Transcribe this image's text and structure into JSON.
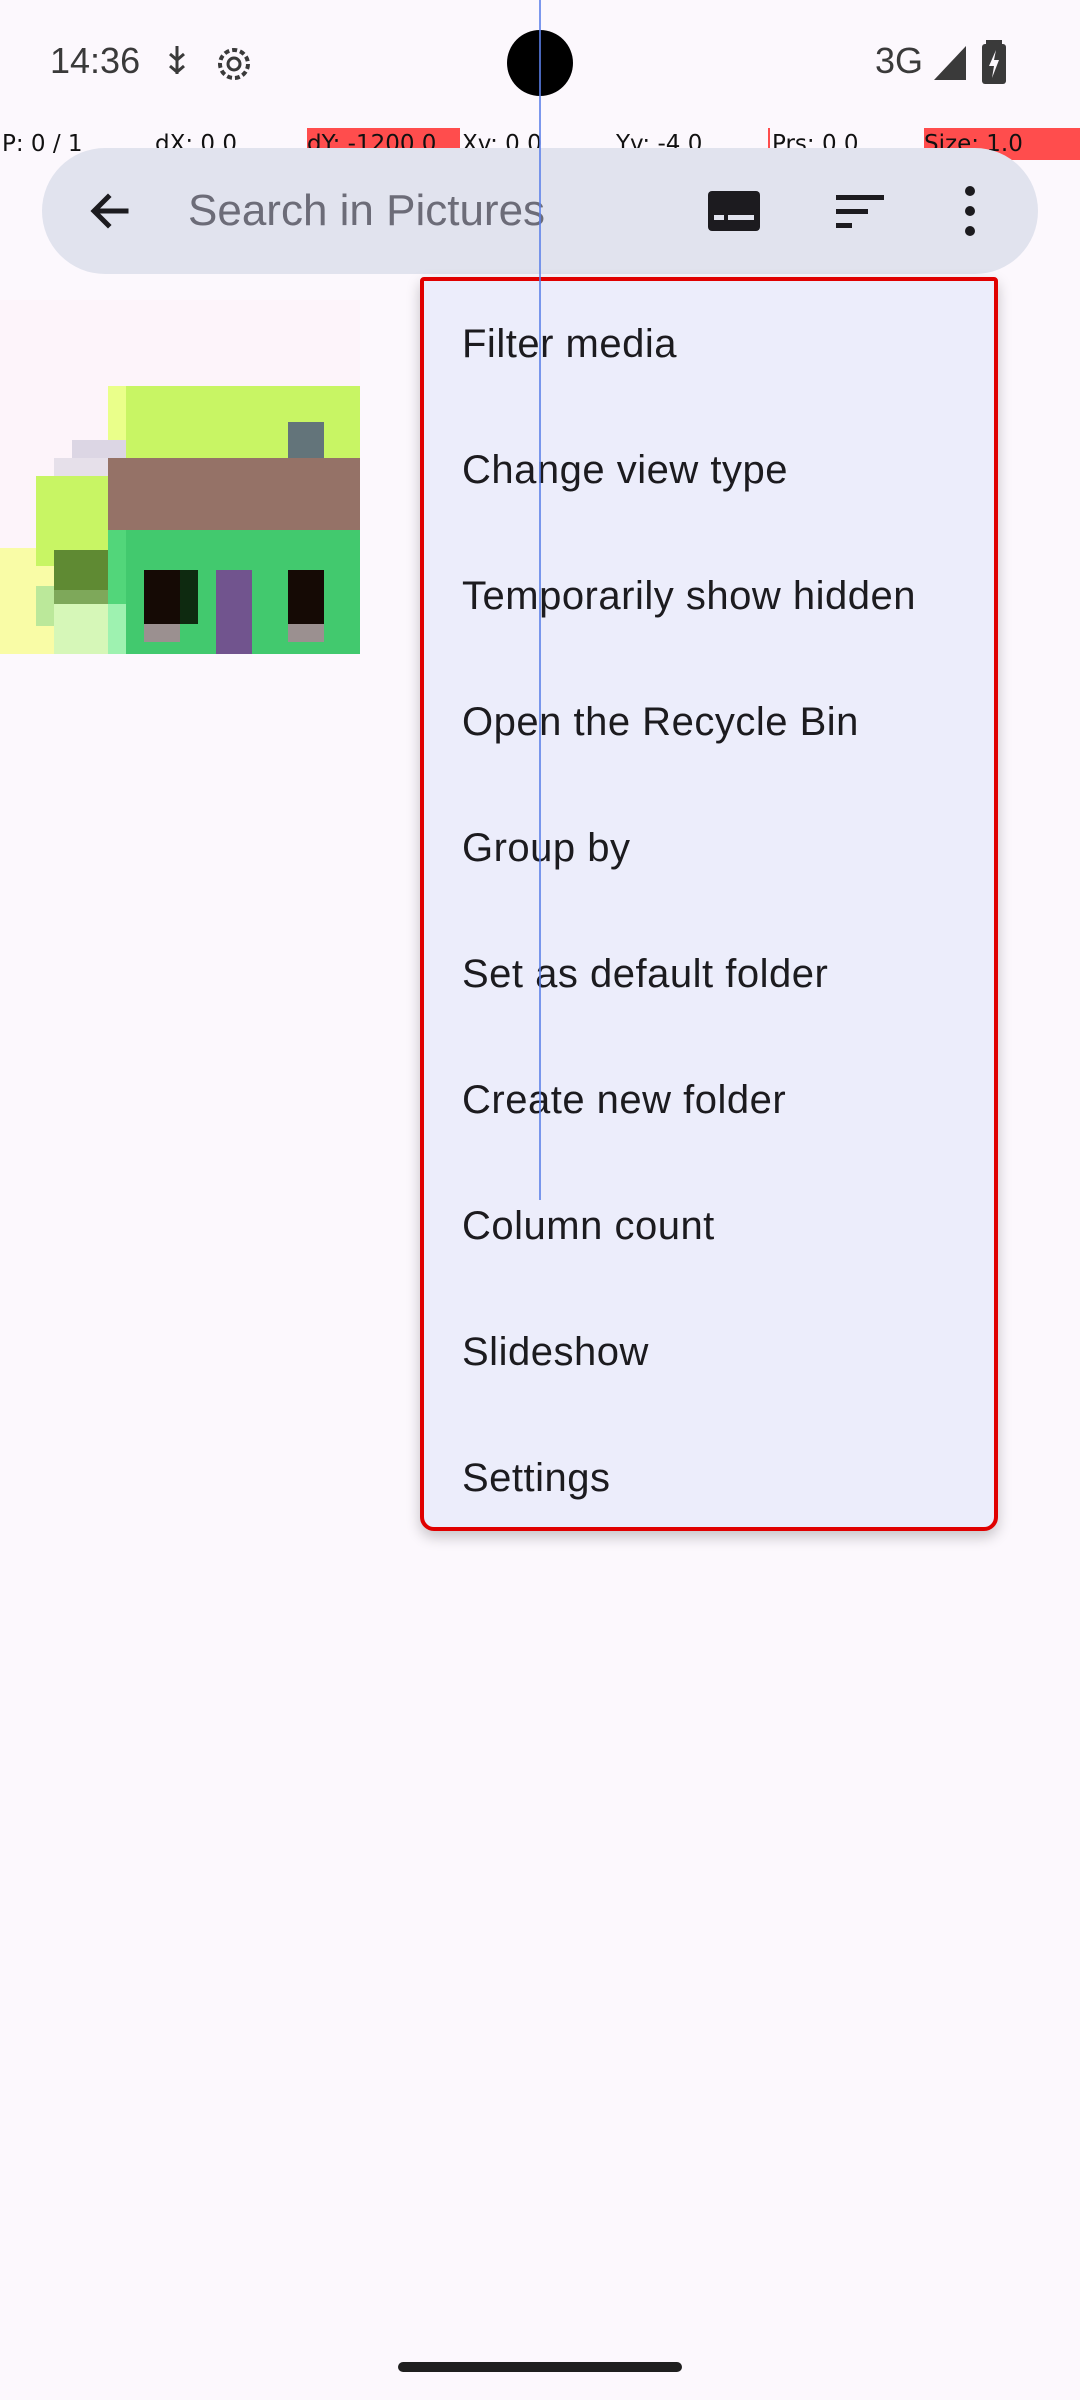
{
  "status_bar": {
    "time": "14:36",
    "network": "3G",
    "icons": [
      "usb-debug-icon",
      "settings-gear-icon",
      "signal-icon",
      "battery-charging-icon"
    ]
  },
  "debug_overlay": {
    "pointers": "P: 0 / 1",
    "dx": "dX: 0.0",
    "dy": "dY: -1200.0",
    "xv": "Xv: 0.0",
    "yv": "Yv: -4.0",
    "prs": "Prs: 0.0",
    "size": "Size: 1.0",
    "highlight_color": "#ff4d4d"
  },
  "toolbar": {
    "search_placeholder": "Search in Pictures",
    "background": "#e1e3ee",
    "icons": [
      "back-arrow-icon",
      "subtitles-icon",
      "sort-icon",
      "more-vert-icon"
    ]
  },
  "menu": {
    "items": [
      {
        "label": "Filter media"
      },
      {
        "label": "Change view type"
      },
      {
        "label": "Temporarily show hidden"
      },
      {
        "label": "Open the Recycle Bin"
      },
      {
        "label": "Group by"
      },
      {
        "label": "Set as default folder"
      },
      {
        "label": "Create new folder"
      },
      {
        "label": "Column count"
      },
      {
        "label": "Slideshow"
      },
      {
        "label": "Settings"
      }
    ],
    "background": "#ecedfb",
    "border_color": "#e00000"
  }
}
